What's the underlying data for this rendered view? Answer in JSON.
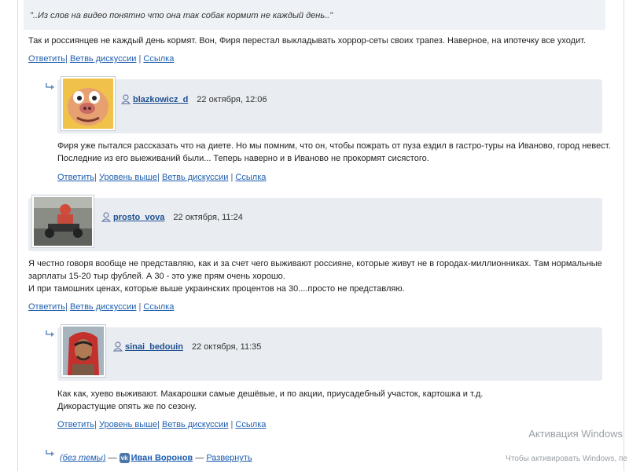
{
  "quote": "\"..Из слов на видео понятно что она так собак кормит не каждый день..\"",
  "comments": [
    {
      "text": [
        "Так и россиянцев не каждый день кормят. Вон, Фиря перестал выкладывать хоррор-сеты своих трапез. Наверное, на ипотечку все уходит."
      ],
      "links": [
        "Ответить",
        "Ветвь дискуссии",
        "Ссылка"
      ]
    },
    {
      "username": "blazkowicz_d",
      "date": "22 октября, 12:06",
      "avatar": "cartoon-pig-face-avatar",
      "text": [
        "Фиря уже пытался рассказать что на диете. Но мы помним, что он, чтобы пожрать от пуза ездил в гастро-туры на Иваново, город невест.",
        "Последние из его выеживаний были... Теперь наверно и в Иваново не прокормят сисястого."
      ],
      "links": [
        "Ответить",
        "Уровень выше",
        "Ветвь дискуссии",
        "Ссылка"
      ]
    },
    {
      "username": "prosto_vova",
      "date": "22 октября, 11:24",
      "avatar": "go-kart-driver-avatar",
      "text": [
        "Я честно говоря вообще не представляю, как и за счет чего выживают россияне, которые живут не в городах-миллионниках. Там нормальные",
        "зарплаты 15-20 тыр фублей. А 30 - это уже прям очень хорошо.",
        "И при тамошних ценах, которые выше украинских процентов на 30....просто не представляю."
      ],
      "links": [
        "Ответить",
        "Ветвь дискуссии",
        "Ссылка"
      ]
    },
    {
      "username": "sinai_bedouin",
      "date": "22 октября, 11:35",
      "avatar": "man-in-red-keffiyeh-avatar",
      "text": [
        "Как как, хуево выживают. Макарошки самые дешёвые, и по акции, приусадебный участок, картошка и т.д.",
        "Дикорастущие опять же по сезону."
      ],
      "links": [
        "Ответить",
        "Уровень выше",
        "Ветвь дискуссии",
        "Ссылка"
      ]
    }
  ],
  "collapsed": {
    "subject": "(без темы)",
    "dash1": "—",
    "author": "Иван Воронов",
    "dash2": "—",
    "expand": "Развернуть",
    "vk_badge": "vk"
  },
  "windows_activation": {
    "title": "Активация Windows",
    "subtitle": "Чтобы активировать Windows, пе"
  },
  "colors": {
    "link": "#1f5fb0",
    "header_bg": "#e9edf2",
    "vk": "#4a76a8"
  }
}
